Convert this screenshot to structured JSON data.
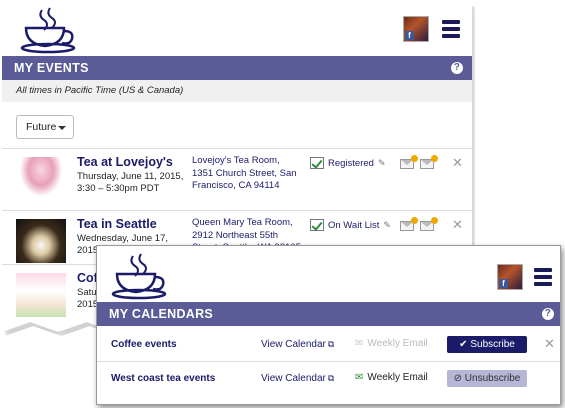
{
  "events_panel": {
    "section_title": "MY EVENTS",
    "timezone_note": "All times in Pacific Time (US & Canada)",
    "filter": {
      "selected": "Future"
    },
    "events": [
      {
        "title": "Tea at Lovejoy's",
        "date_line1": "Thursday, June 11, 2015,",
        "date_line2": "3:30 – 5:30pm PDT",
        "venue": "Lovejoy's Tea Room,",
        "address_line1": "1351 Church Street, San",
        "address_line2": "Francisco, CA 94114",
        "status": "Registered"
      },
      {
        "title": "Tea in Seattle",
        "date_line1": "Wednesday, June 17,",
        "date_line2": "2015",
        "venue": "Queen Mary Tea Room,",
        "address_line1": "2912 Northeast 55th",
        "address_line2": "Street, Seattle, WA 98105",
        "status": "On Wait List"
      },
      {
        "title": "Cof",
        "date_line1": "Satu",
        "date_line2": "2015"
      }
    ]
  },
  "calendars_panel": {
    "section_title": "MY CALENDARS",
    "calendars": [
      {
        "name": "Coffee events",
        "view_label": "View Calendar",
        "weekly_label": "Weekly Email",
        "action_label": "Subscribe"
      },
      {
        "name": "West coast tea events",
        "view_label": "View Calendar",
        "weekly_label": "Weekly Email",
        "action_label": "Unsubscribe"
      }
    ]
  },
  "colors": {
    "header_bar": "#5b5b97",
    "brand_navy": "#1b1b6a",
    "subscribe_btn": "#1b1b6a",
    "unsubscribe_btn": "#b6b6d6",
    "check_green": "#2e8b3a",
    "alert_orange": "#f0a800"
  },
  "icons": [
    "teacup-logo",
    "facebook-avatar",
    "hamburger-menu-icon",
    "help-icon",
    "registered-check-icon",
    "pencil-icon",
    "email-alert-icon",
    "bell-email-icon",
    "close-icon",
    "external-link-icon",
    "weekly-email-icon",
    "check-icon",
    "ban-icon"
  ]
}
